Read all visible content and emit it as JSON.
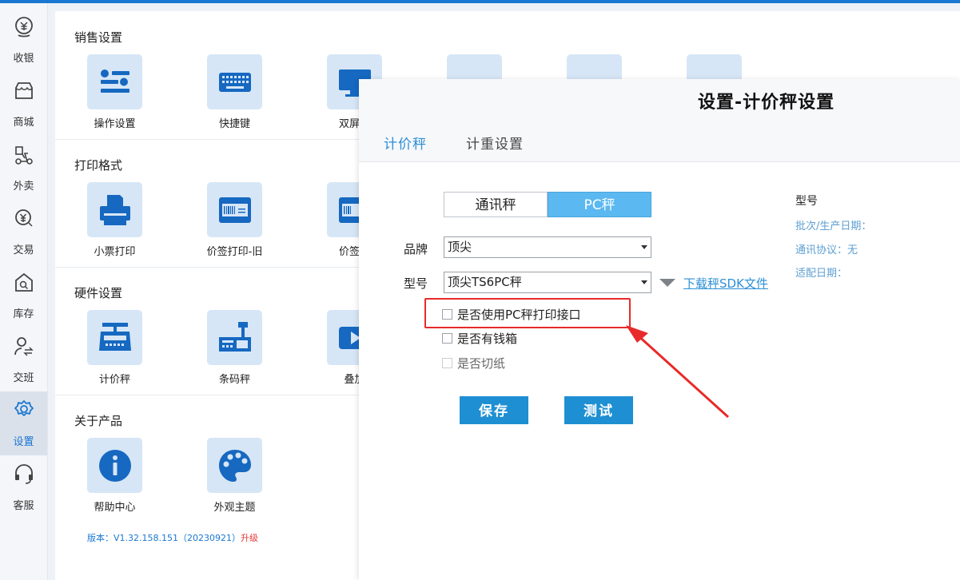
{
  "sidebar": {
    "items": [
      {
        "label": "收银",
        "icon": "cashier-icon"
      },
      {
        "label": "商城",
        "icon": "store-icon"
      },
      {
        "label": "外卖",
        "icon": "delivery-icon"
      },
      {
        "label": "交易",
        "icon": "yuan-search-icon"
      },
      {
        "label": "库存",
        "icon": "inventory-icon"
      },
      {
        "label": "交班",
        "icon": "shift-handover-icon"
      },
      {
        "label": "设置",
        "icon": "gear-icon",
        "active": true
      },
      {
        "label": "客服",
        "icon": "headset-icon"
      }
    ]
  },
  "sections": [
    {
      "title": "销售设置",
      "tiles": [
        {
          "label": "操作设置",
          "icon": "sliders-icon"
        },
        {
          "label": "快捷键",
          "icon": "keyboard-icon"
        },
        {
          "label": "双屏设",
          "icon": "monitor-icon"
        }
      ]
    },
    {
      "title": "打印格式",
      "tiles": [
        {
          "label": "小票打印",
          "icon": "printer-icon"
        },
        {
          "label": "价签打印-旧",
          "icon": "barcode-card-icon"
        },
        {
          "label": "价签扌",
          "icon": "barcode-card-icon"
        }
      ]
    },
    {
      "title": "硬件设置",
      "tiles": [
        {
          "label": "计价秤",
          "icon": "price-scale-icon"
        },
        {
          "label": "条码秤",
          "icon": "barcode-scale-icon"
        },
        {
          "label": "叠加",
          "icon": "video-play-icon"
        }
      ]
    },
    {
      "title": "关于产品",
      "tiles": [
        {
          "label": "帮助中心",
          "icon": "info-icon"
        },
        {
          "label": "外观主题",
          "icon": "palette-icon"
        }
      ]
    }
  ],
  "version": {
    "text": "版本：V1.32.158.151（20230921）",
    "upgrade": "升级"
  },
  "dialog": {
    "title": "设置-计价秤设置",
    "tabs": [
      "计价秤",
      "计重设置"
    ],
    "segment": [
      "通讯秤",
      "PC秤"
    ],
    "brand_label": "品牌",
    "brand_value": "顶尖",
    "model_label": "型号",
    "model_value": "顶尖TS6PC秤",
    "download_link": "下载秤SDK文件",
    "checkboxes": [
      {
        "label": "是否使用PC秤打印接口",
        "enabled": true,
        "checked": false
      },
      {
        "label": "是否有钱箱",
        "enabled": true,
        "checked": false
      },
      {
        "label": "是否切纸",
        "enabled": false,
        "checked": false
      }
    ],
    "save_label": "保存",
    "test_label": "测试",
    "info": {
      "heading": "型号",
      "batch": "批次/生产日期：",
      "protocol": "通讯协议：无",
      "adapt_date": "适配日期："
    }
  },
  "colors": {
    "accent": "#1a77d2",
    "button": "#1e8fd2",
    "annotation": "#e82a2a"
  }
}
